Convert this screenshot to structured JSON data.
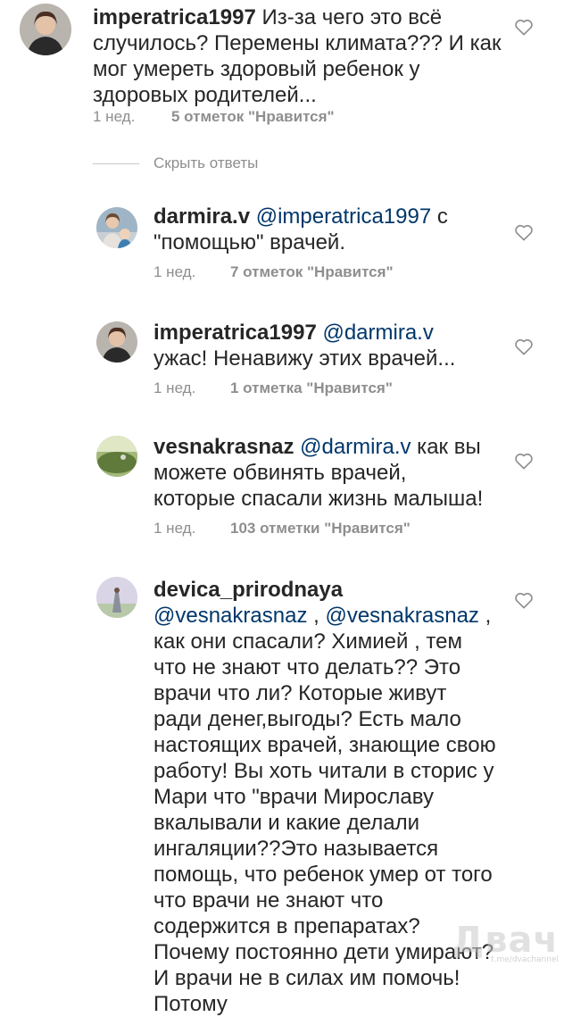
{
  "comments": [
    {
      "username": "imperatrica1997",
      "mention": "",
      "body": " Из-за чего это всё случилось? Перемены климата??? И как мог умереть здоровый ребенок у здоровых родителей...",
      "time": "1 нед.",
      "likes": "5 отметок \"Нравится\""
    },
    {
      "username": "darmira.v",
      "mention": "@imperatrica1997",
      "body": " с \"помощью\" врачей.",
      "time": "1 нед.",
      "likes": "7 отметок \"Нравится\""
    },
    {
      "username": "imperatrica1997",
      "mention": "@darmira.v",
      "body": " ужас! Ненавижу этих врачей...",
      "time": "1 нед.",
      "likes": "1 отметка \"Нравится\""
    },
    {
      "username": "vesnakrasnaz",
      "mention": "@darmira.v",
      "body": " как вы можете обвинять врачей, которые спасали жизнь малыша!",
      "time": "1 нед.",
      "likes": "103 отметки \"Нравится\""
    },
    {
      "username": "devica_prirodnaya",
      "mention": "@vesnakrasnaz",
      "mention2": "@vesnakrasnaz",
      "body_a": " ,",
      "body_b": " , как они спасали? Химией , тем что не знают что делать?? Это врачи что ли? Которые живут ради денег,выгоды? Есть мало настоящих врачей, знающие свою работу! Вы хоть читали в сторис у Мари что \"врачи Мирославу вкалывали и какие делали ингаляции??Это называется помощь, что ребенок умер от того что врачи не знают что содержится в препаратах? Почему постоянно дети умирают? И врачи не в силах им помочь! Потому"
    }
  ],
  "hide_replies_label": "Скрыть ответы",
  "watermark": "Двач",
  "watermark_sub": "t.me/dvachannel",
  "colors": {
    "mention": "#00376b",
    "meta": "#8e8e8e",
    "text": "#262626"
  },
  "icons": [
    "heart-outline-icon"
  ]
}
